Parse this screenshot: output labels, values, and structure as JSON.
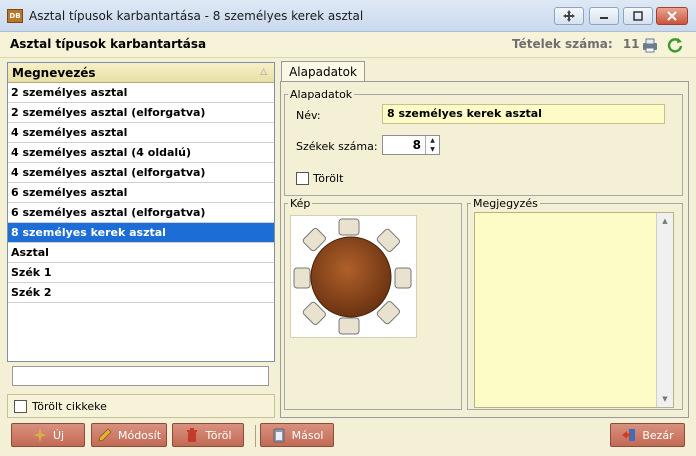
{
  "window": {
    "title": "Asztal típusok karbantartása - 8 személyes kerek asztal",
    "icon_text": "DB"
  },
  "header": {
    "title": "Asztal típusok karbantartása",
    "count_label": "Tételek száma:",
    "count": "11"
  },
  "list": {
    "column": "Megnevezés",
    "items": [
      "2 személyes asztal",
      "2 személyes asztal (elforgatva)",
      "4 személyes asztal",
      "4 személyes asztal (4 oldalú)",
      "4 személyes asztal (elforgatva)",
      "6 személyes asztal",
      "6 személyes asztal (elforgatva)",
      "8 személyes kerek asztal",
      "Asztal",
      "Szék 1",
      "Szék 2"
    ],
    "selected_index": 7,
    "filter_value": "",
    "show_deleted_label": "Törölt cikkeke",
    "show_deleted_checked": false
  },
  "detail": {
    "tab": "Alapadatok",
    "group_title": "Alapadatok",
    "name_label": "Név:",
    "name_value": "8 személyes kerek asztal",
    "chairs_label": "Székek száma:",
    "chairs_value": "8",
    "deleted_label": "Törölt",
    "deleted_checked": false,
    "image_title": "Kép",
    "notes_title": "Megjegyzés",
    "notes_value": ""
  },
  "toolbar": {
    "new": "Új",
    "edit": "Módosít",
    "delete": "Töröl",
    "copy": "Másol",
    "close": "Bezár"
  },
  "colors": {
    "selection": "#1c6ed6",
    "button": "#c97663",
    "field_yellow": "#fdfbc6",
    "background": "#f4f0d6"
  }
}
